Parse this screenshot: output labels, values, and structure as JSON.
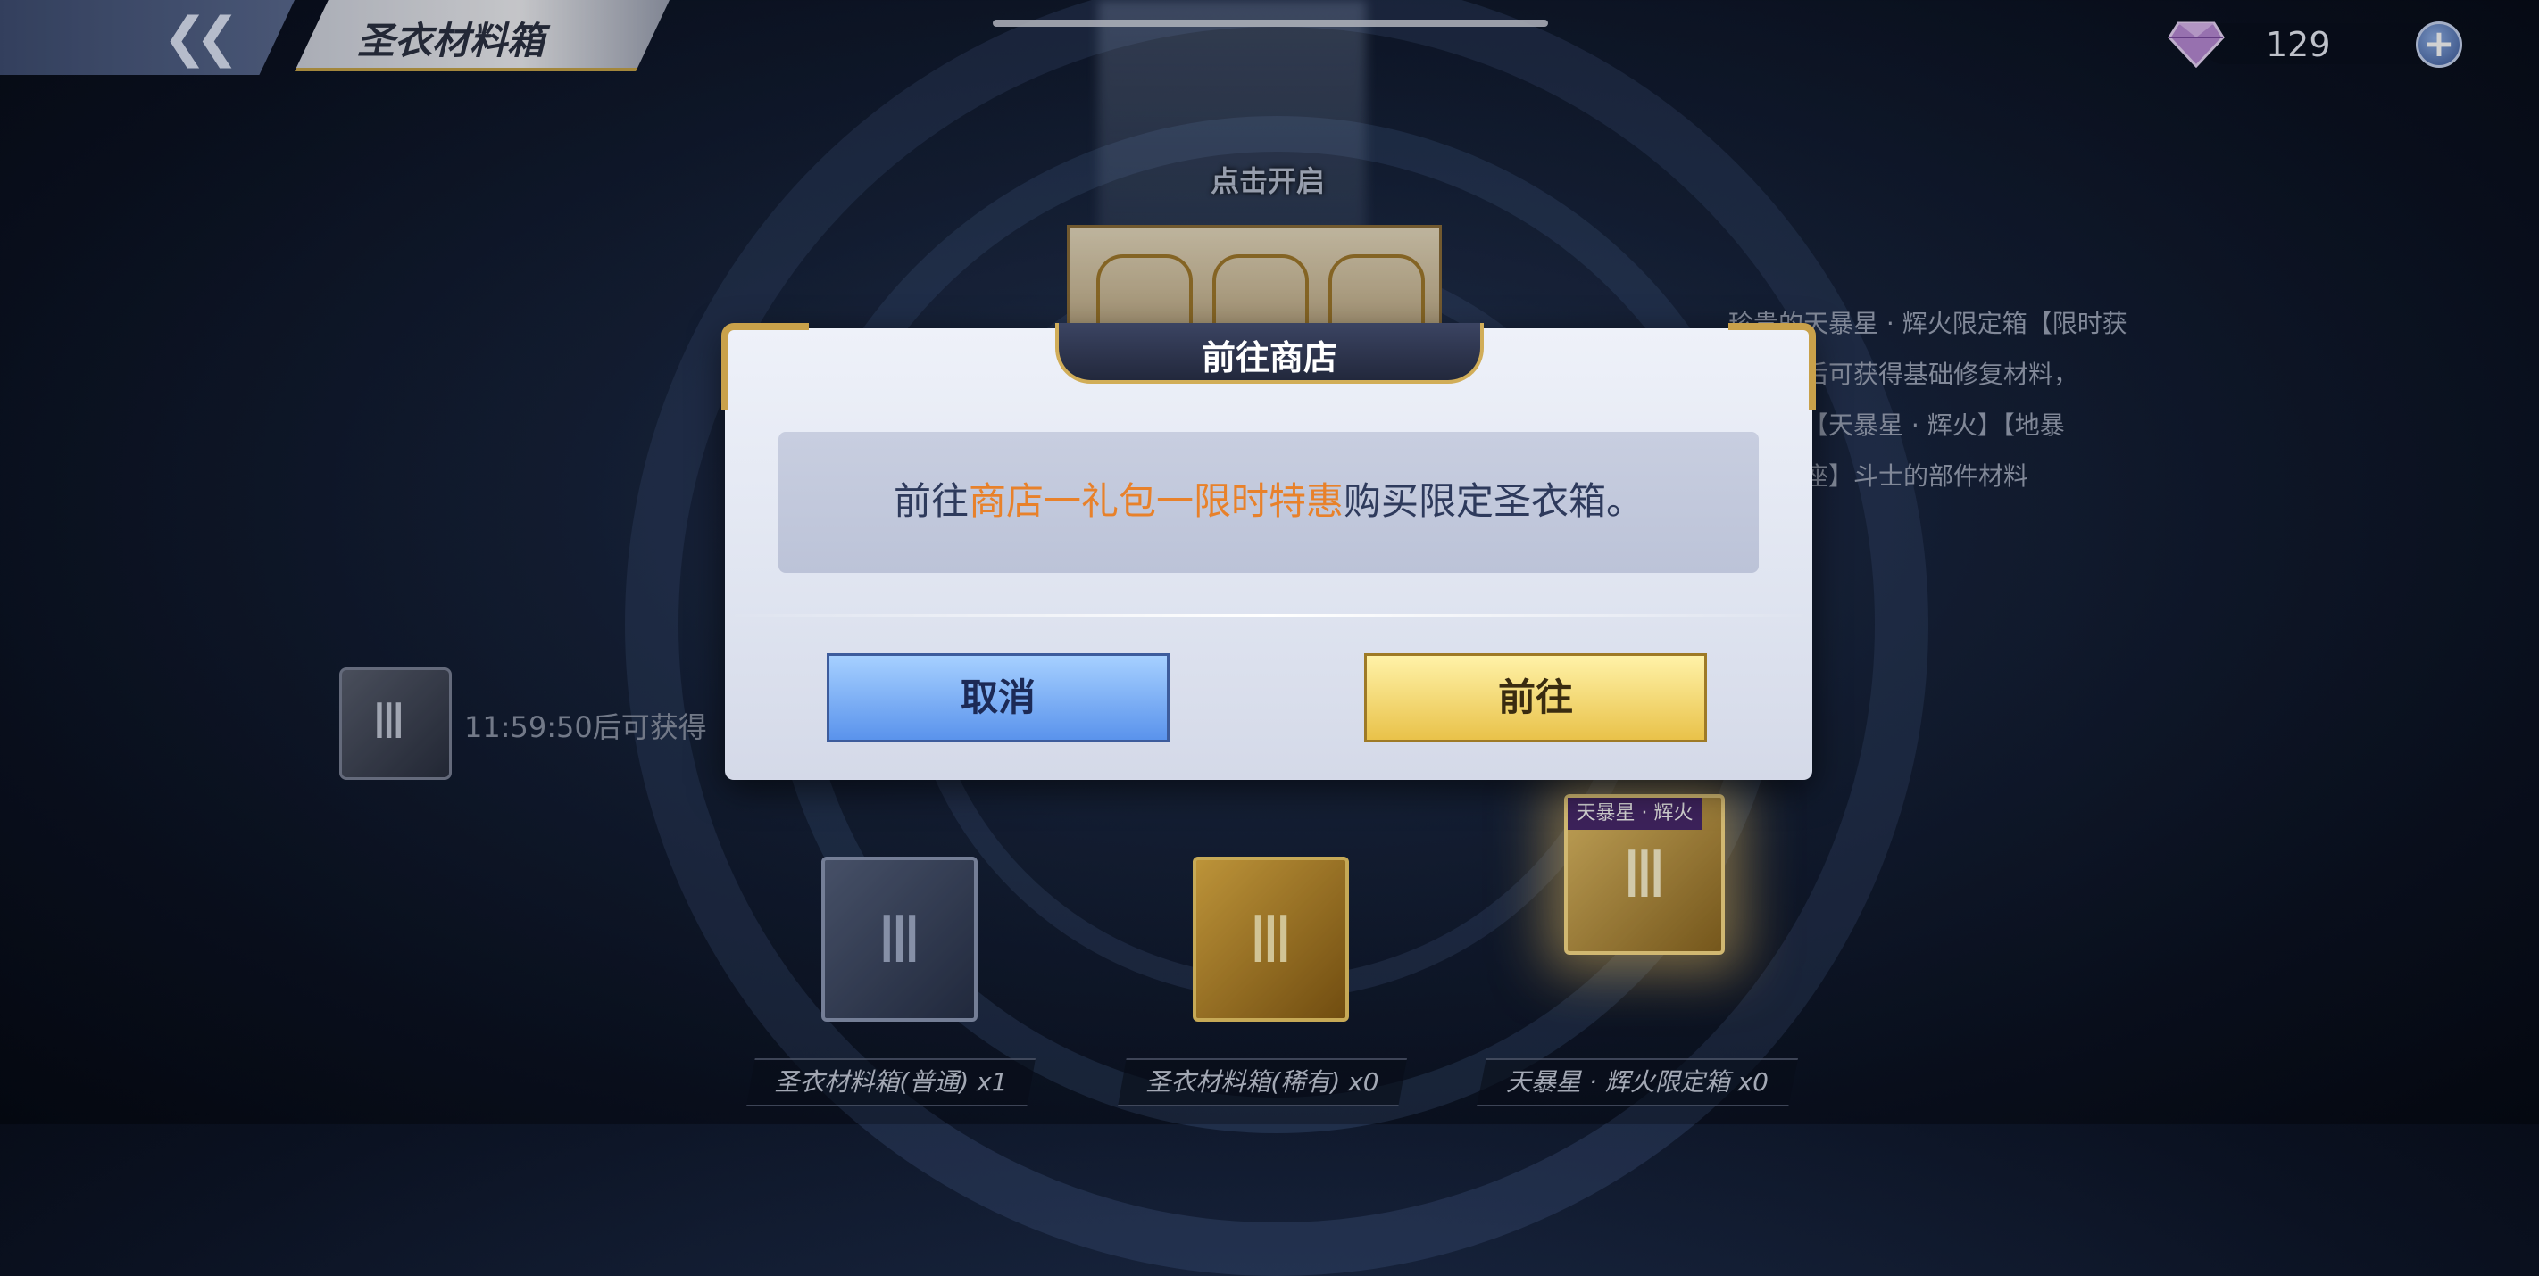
{
  "header": {
    "title": "圣衣材料箱",
    "back_icon": "double-chevron-left-icon"
  },
  "currency": {
    "icon": "purple-gem-icon",
    "value": "129",
    "plus_icon": "plus-icon",
    "plus_label": "+"
  },
  "main": {
    "tap_hint": "点击开启",
    "description_lines": [
      "珍贵的天暴星 · 辉火限定箱【限时获",
      "，开启后可获得基础修复材料，",
      "率获得【天暴星 · 辉火】【地暴",
      "【仙女座】斗士的部件材料"
    ],
    "timer": {
      "text": "11:59:50后可获得",
      "icon_glyph": "Ⅲ"
    }
  },
  "chests": [
    {
      "label": "圣衣材料箱(普通) x1",
      "emblem": "Ⅲ"
    },
    {
      "label": "圣衣材料箱(稀有) x0",
      "emblem": "Ⅲ"
    },
    {
      "label": "天暴星 · 辉火限定箱 x0",
      "emblem": "Ⅲ",
      "tag": "天暴星 · 辉火"
    }
  ],
  "dialog": {
    "title": "前往商店",
    "message_prefix": "前往",
    "message_highlight": "商店一礼包一限时特惠",
    "message_suffix": "购买限定圣衣箱。",
    "cancel_label": "取消",
    "confirm_label": "前往"
  },
  "colors": {
    "highlight": "#e8812a",
    "gold": "#c9a14a"
  }
}
